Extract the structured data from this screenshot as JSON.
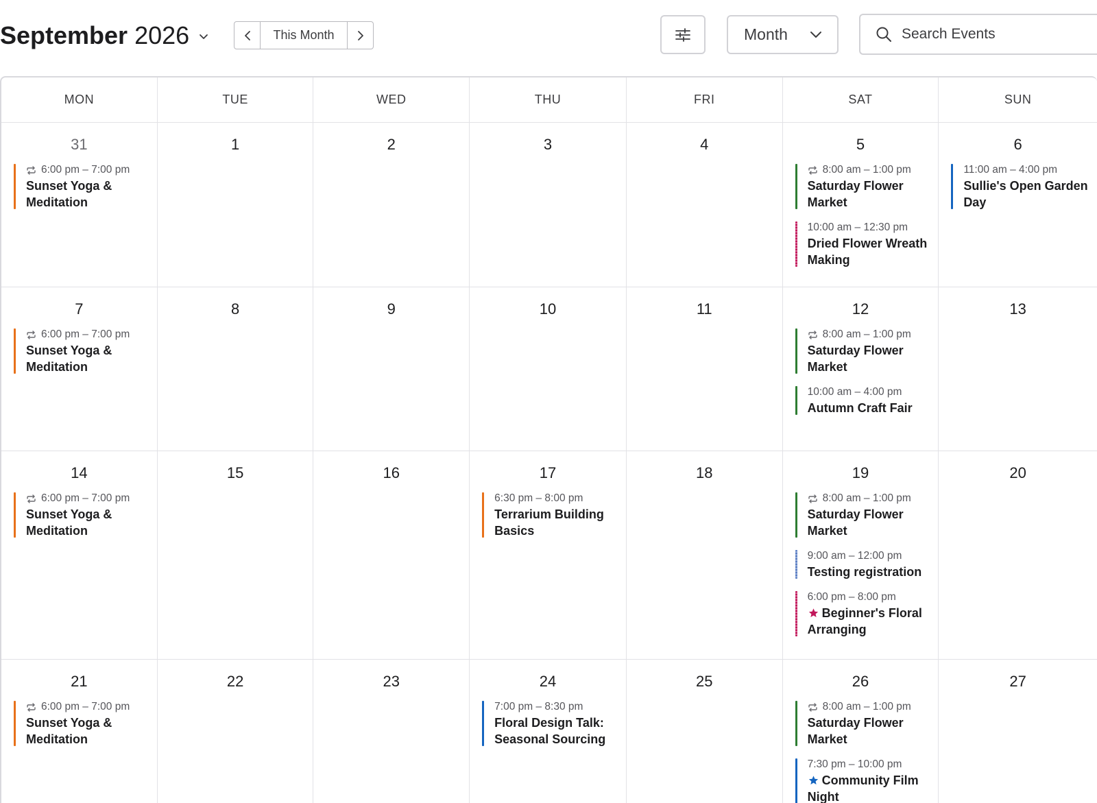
{
  "header": {
    "month_name": "September",
    "year": "2026",
    "today_label": "This Month",
    "view_value": "Month",
    "search_placeholder": "Search Events"
  },
  "colors": {
    "orange": "#e8711a",
    "green": "#2e7d32",
    "blue": "#1565c0",
    "magenta": "#c2185b",
    "light_blue": "#5c7fc4"
  },
  "weekdays": [
    "MON",
    "TUE",
    "WED",
    "THU",
    "FRI",
    "SAT",
    "SUN"
  ],
  "weeks": [
    {
      "days": [
        {
          "num": "31",
          "events": [
            {
              "time": "6:00 pm – 7:00 pm",
              "name": "Sunset Yoga & Meditation",
              "recurring": true,
              "color": "orange"
            }
          ]
        },
        {
          "num": "1",
          "events": []
        },
        {
          "num": "2",
          "events": []
        },
        {
          "num": "3",
          "events": []
        },
        {
          "num": "4",
          "events": []
        },
        {
          "num": "5",
          "events": [
            {
              "time": "8:00 am – 1:00 pm",
              "name": "Saturday Flower Market",
              "recurring": true,
              "color": "green"
            },
            {
              "time": "10:00 am – 12:30 pm",
              "name": "Dried Flower Wreath Making",
              "color": "magenta"
            }
          ]
        },
        {
          "num": "6",
          "events": [
            {
              "time": "11:00 am – 4:00 pm",
              "name": "Sullie's Open Garden Day",
              "color": "blue"
            }
          ]
        }
      ]
    },
    {
      "days": [
        {
          "num": "7",
          "events": [
            {
              "time": "6:00 pm – 7:00 pm",
              "name": "Sunset Yoga & Meditation",
              "recurring": true,
              "color": "orange"
            }
          ]
        },
        {
          "num": "8",
          "events": []
        },
        {
          "num": "9",
          "events": []
        },
        {
          "num": "10",
          "events": []
        },
        {
          "num": "11",
          "events": []
        },
        {
          "num": "12",
          "events": [
            {
              "time": "8:00 am – 1:00 pm",
              "name": "Saturday Flower Market",
              "recurring": true,
              "color": "green"
            },
            {
              "time": "10:00 am – 4:00 pm",
              "name": "Autumn Craft Fair",
              "color": "green"
            }
          ]
        },
        {
          "num": "13",
          "events": []
        }
      ]
    },
    {
      "days": [
        {
          "num": "14",
          "events": [
            {
              "time": "6:00 pm – 7:00 pm",
              "name": "Sunset Yoga & Meditation",
              "recurring": true,
              "color": "orange"
            }
          ]
        },
        {
          "num": "15",
          "events": []
        },
        {
          "num": "16",
          "events": []
        },
        {
          "num": "17",
          "events": [
            {
              "time": "6:30 pm – 8:00 pm",
              "name": "Terrarium Building Basics",
              "color": "orange"
            }
          ]
        },
        {
          "num": "18",
          "events": []
        },
        {
          "num": "19",
          "events": [
            {
              "time": "8:00 am – 1:00 pm",
              "name": "Saturday Flower Market",
              "recurring": true,
              "color": "green"
            },
            {
              "time": "9:00 am – 12:00 pm",
              "name": "Testing registration",
              "color": "light_blue"
            },
            {
              "time": "6:00 pm – 8:00 pm",
              "name": "Beginner's Floral Arranging",
              "featured": true,
              "color": "magenta"
            }
          ]
        },
        {
          "num": "20",
          "events": []
        }
      ]
    },
    {
      "days": [
        {
          "num": "21",
          "events": [
            {
              "time": "6:00 pm – 7:00 pm",
              "name": "Sunset Yoga & Meditation",
              "recurring": true,
              "color": "orange"
            }
          ]
        },
        {
          "num": "22",
          "events": []
        },
        {
          "num": "23",
          "events": []
        },
        {
          "num": "24",
          "events": [
            {
              "time": "7:00 pm – 8:30 pm",
              "name": "Floral Design Talk: Seasonal Sourcing",
              "color": "blue"
            }
          ]
        },
        {
          "num": "25",
          "events": []
        },
        {
          "num": "26",
          "events": [
            {
              "time": "8:00 am – 1:00 pm",
              "name": "Saturday Flower Market",
              "recurring": true,
              "color": "green"
            },
            {
              "time": "7:30 pm – 10:00 pm",
              "name": "Community Film Night",
              "featured": true,
              "color": "blue"
            }
          ]
        },
        {
          "num": "27",
          "events": []
        }
      ]
    }
  ]
}
